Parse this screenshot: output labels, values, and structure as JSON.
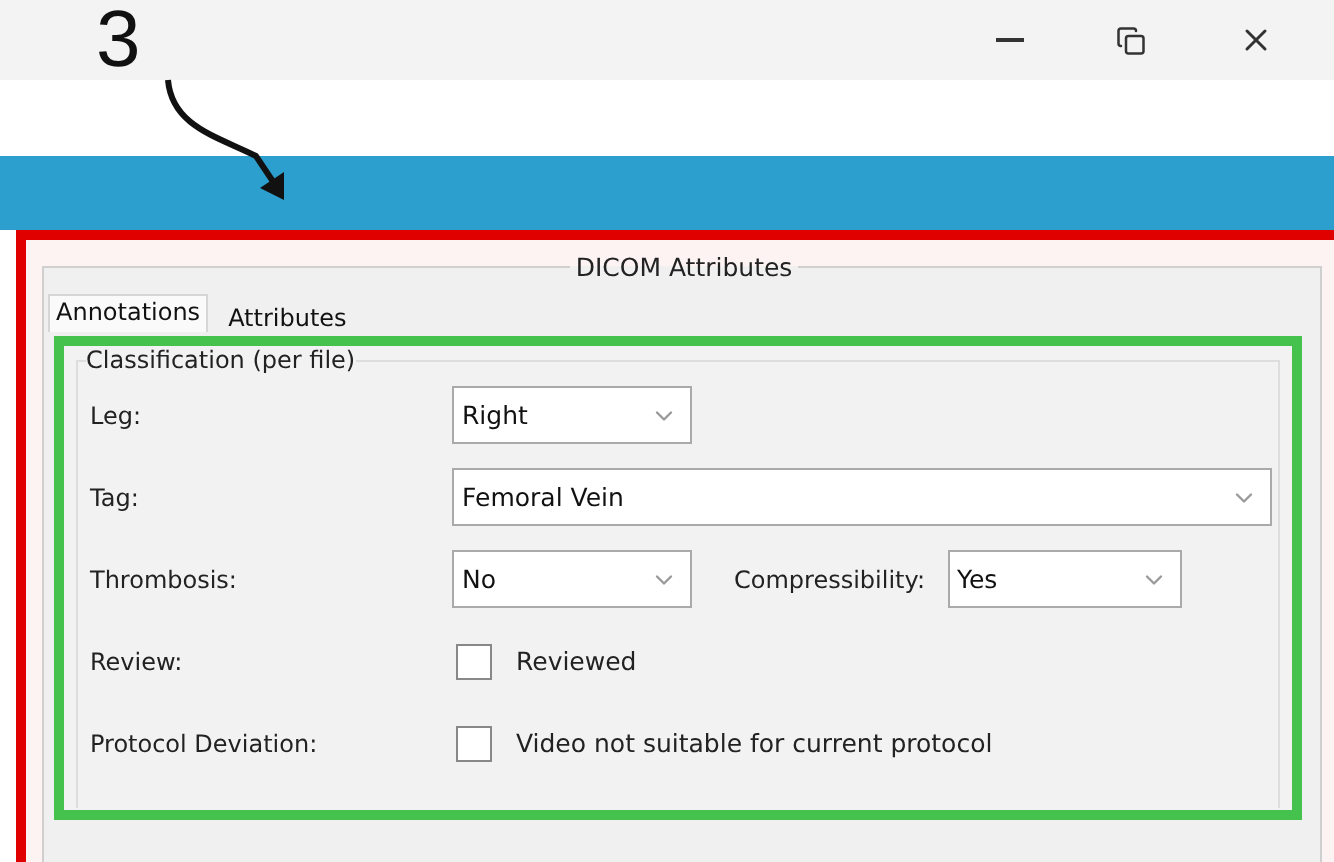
{
  "annotation": {
    "step": "3"
  },
  "panel": {
    "title": "DICOM Attributes",
    "tabs": [
      {
        "label": "Annotations",
        "selected": true
      },
      {
        "label": "Attributes",
        "selected": false
      }
    ],
    "group": {
      "title": "Classification (per file)",
      "rows": [
        {
          "kind": "short",
          "label": "Leg:",
          "value": "Right"
        },
        {
          "kind": "wide",
          "label": "Tag:",
          "value": "Femoral Vein"
        },
        {
          "kind": "pair",
          "label": "Thrombosis:",
          "value": "No",
          "label_2": "Compressibility:",
          "value_2": "Yes"
        },
        {
          "kind": "check",
          "label": "Review:",
          "text": "Reviewed",
          "checked": false
        },
        {
          "kind": "check",
          "label": "Protocol Deviation:",
          "text": "Video not suitable for current protocol",
          "checked": false
        }
      ]
    }
  }
}
